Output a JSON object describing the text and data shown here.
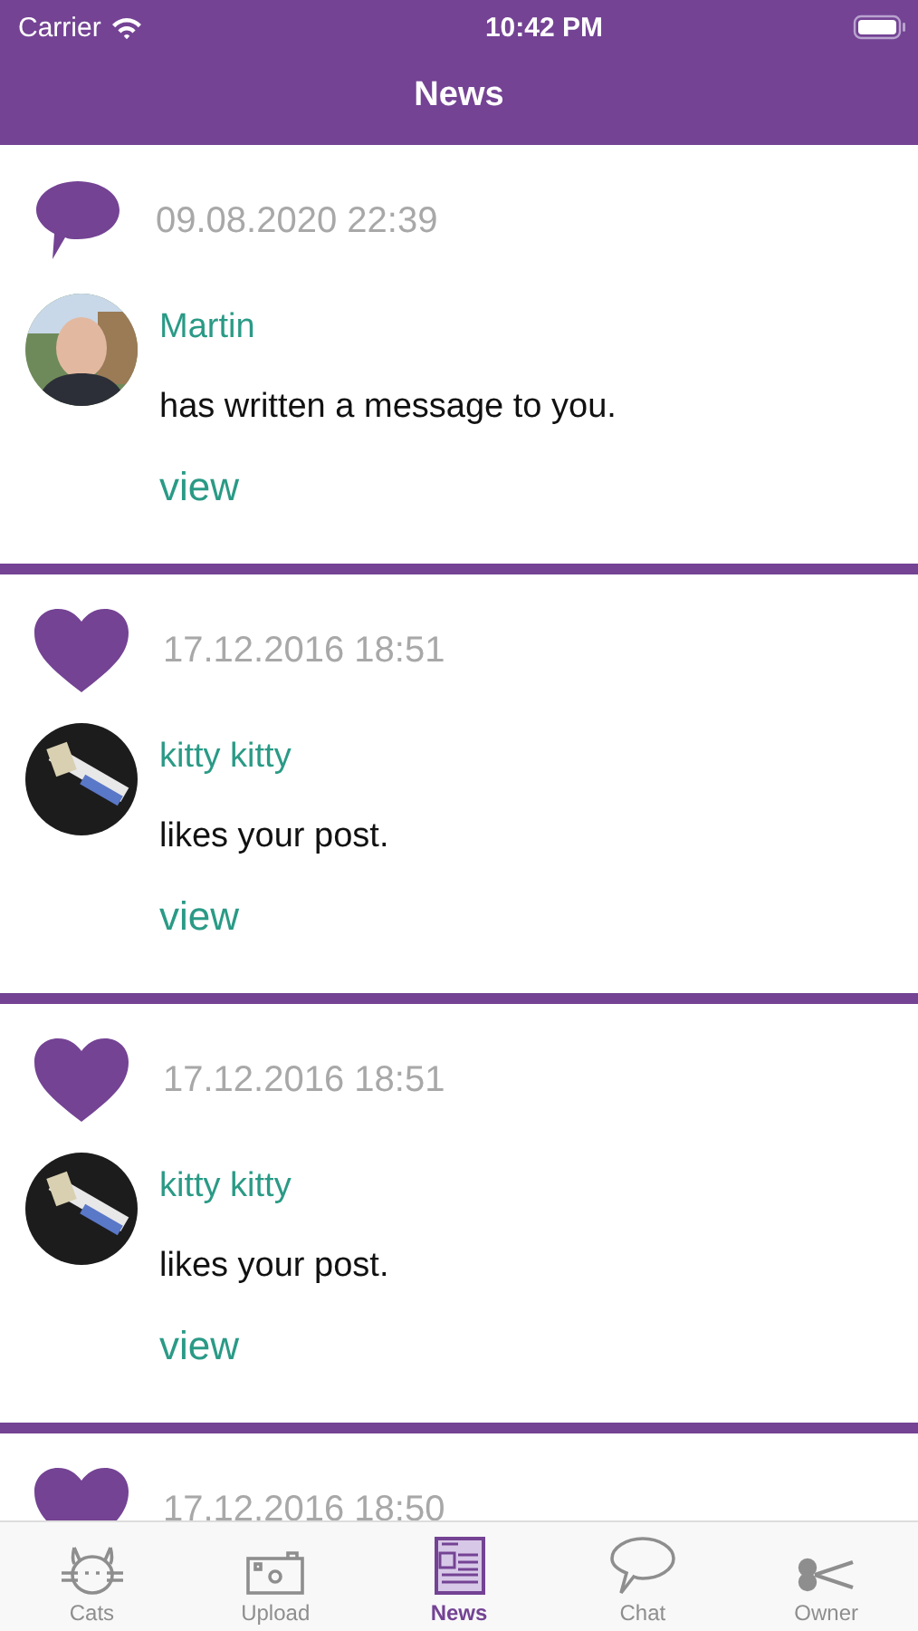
{
  "status_bar": {
    "carrier": "Carrier",
    "time": "10:42 PM"
  },
  "nav": {
    "title": "News"
  },
  "feed": [
    {
      "kind": "message",
      "date": "09.08.2020 22:39",
      "user": "Martin",
      "text": "has written a message to you.",
      "link": "view"
    },
    {
      "kind": "like",
      "date": "17.12.2016 18:51",
      "user": "kitty kitty",
      "text": "likes your post.",
      "link": "view"
    },
    {
      "kind": "like",
      "date": "17.12.2016 18:51",
      "user": "kitty kitty",
      "text": "likes your post.",
      "link": "view"
    },
    {
      "kind": "like",
      "date": "17.12.2016 18:50"
    }
  ],
  "tabs": [
    {
      "kind": "cat",
      "label": "Cats",
      "selected": false
    },
    {
      "kind": "camera",
      "label": "Upload",
      "selected": false
    },
    {
      "kind": "news",
      "label": "News",
      "selected": true
    },
    {
      "kind": "chat",
      "label": "Chat",
      "selected": false
    },
    {
      "kind": "scissors",
      "label": "Owner",
      "selected": false
    }
  ]
}
